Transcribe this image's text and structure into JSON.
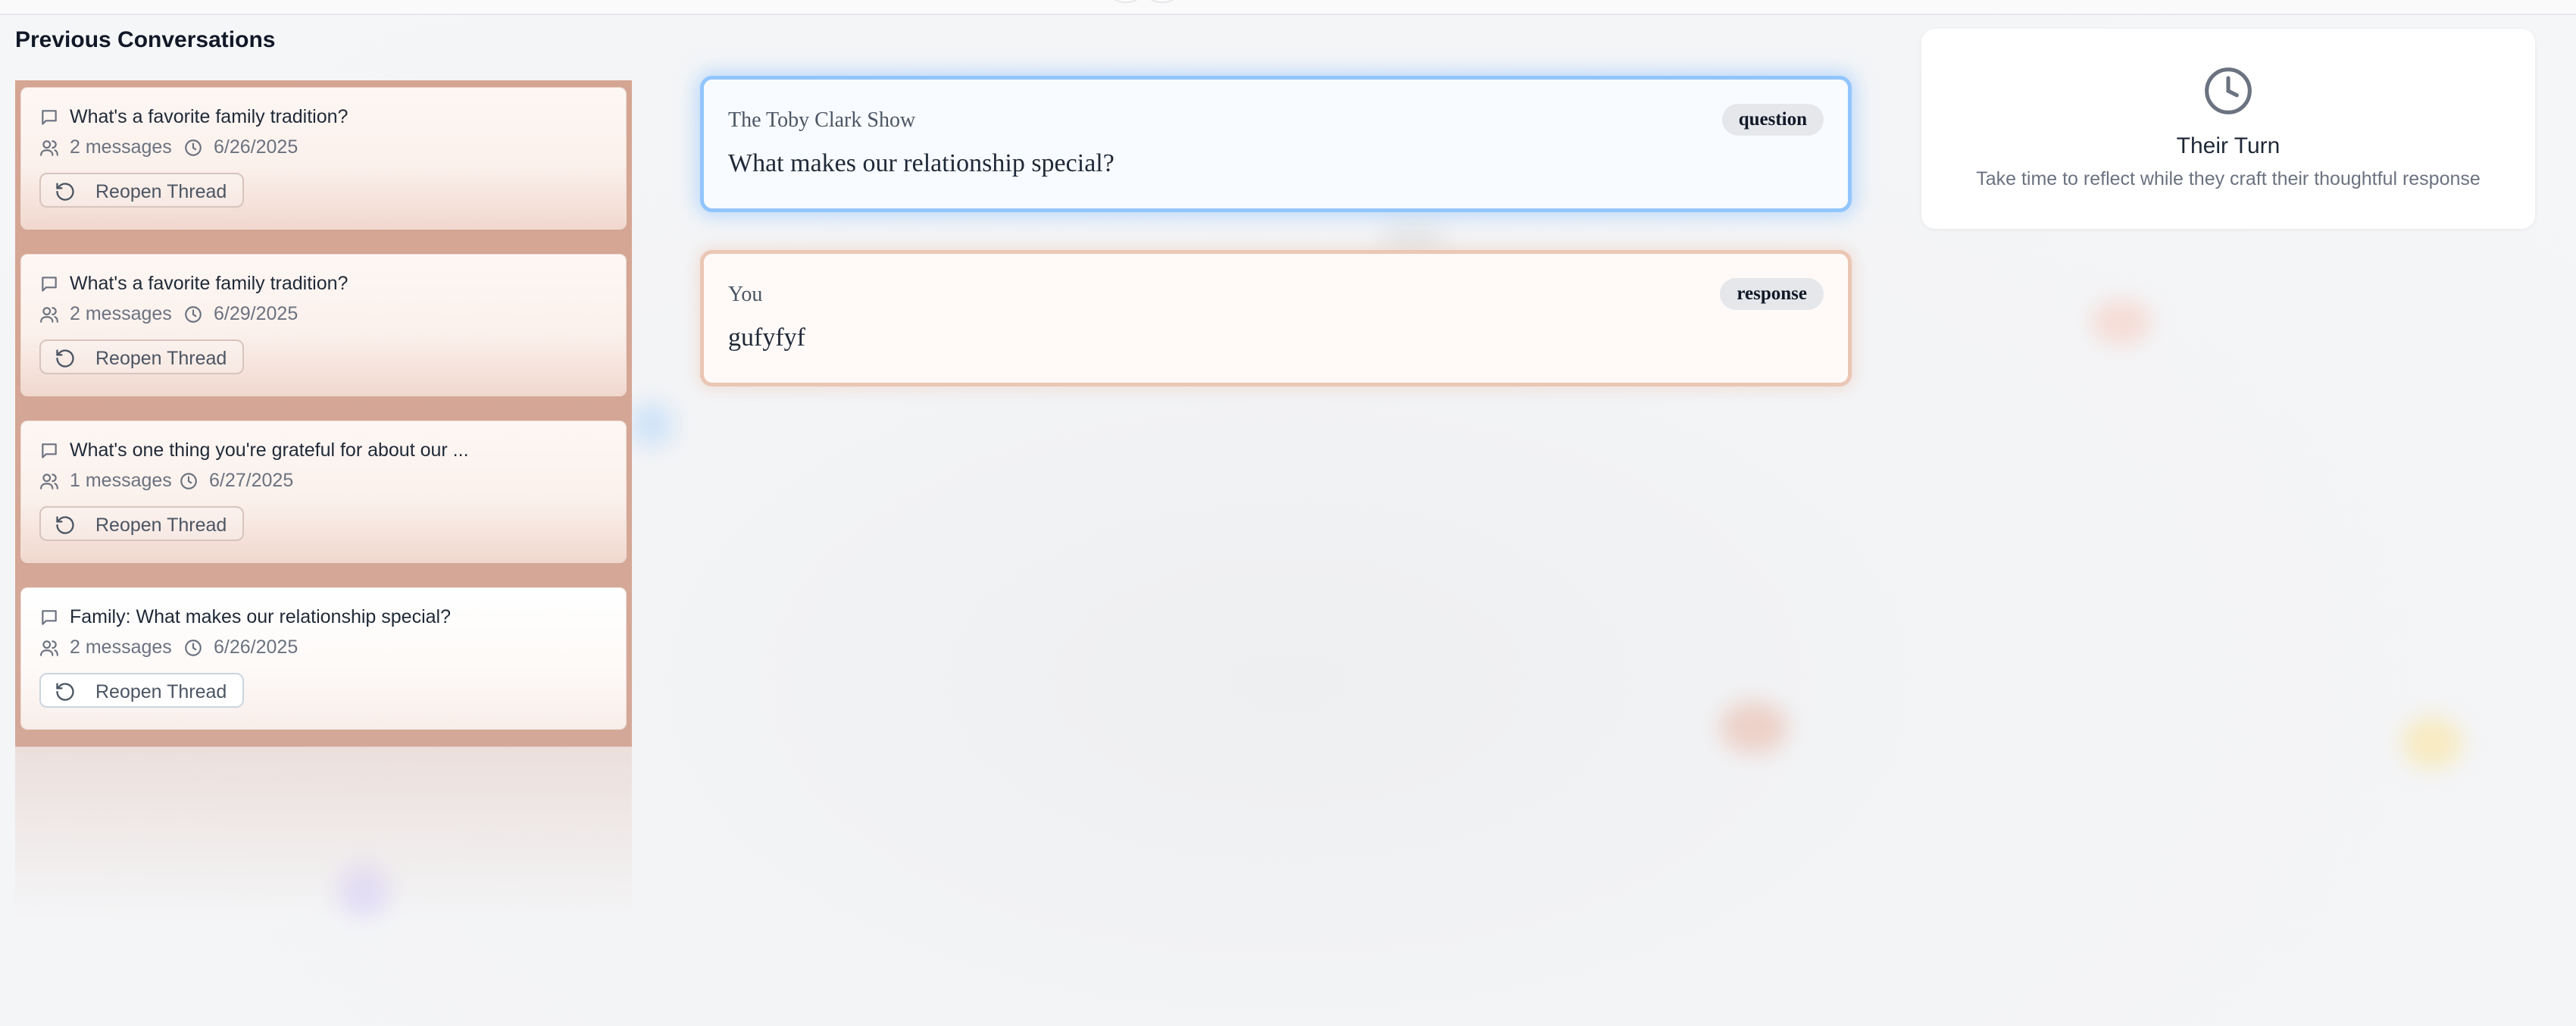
{
  "sidebar": {
    "title": "Previous Conversations",
    "threads": [
      {
        "title": "What's a favorite family tradition?",
        "messages": "2 messages",
        "date": "6/26/2025",
        "action": "Reopen Thread"
      },
      {
        "title": "What's a favorite family tradition?",
        "messages": "2 messages",
        "date": "6/29/2025",
        "action": "Reopen Thread"
      },
      {
        "title": "What's one thing you're grateful for about our ...",
        "messages": "1 messages",
        "date": "6/27/2025",
        "action": "Reopen Thread"
      },
      {
        "title": "Family: What makes our relationship special?",
        "messages": "2 messages",
        "date": "6/26/2025",
        "action": "Reopen Thread"
      }
    ]
  },
  "conversation": {
    "question": {
      "author": "The Toby Clark Show",
      "tag": "question",
      "text": "What makes our relationship special?"
    },
    "response": {
      "author": "You",
      "tag": "response",
      "text": "gufyfyf"
    }
  },
  "status": {
    "icon": "clock-icon",
    "title": "Their Turn",
    "subtitle": "Take time to reflect while they craft their thoughtful response"
  },
  "colors": {
    "question_border": "#93c5fd",
    "response_border": "#ebc6b4",
    "sidebar_panel": "#d5a593"
  }
}
